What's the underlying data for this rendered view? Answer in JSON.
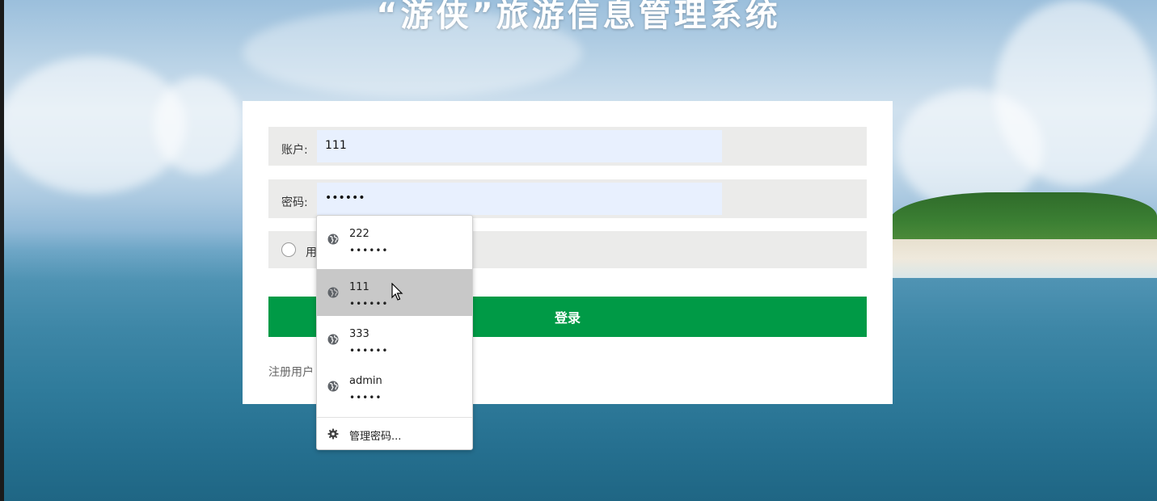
{
  "page": {
    "title": "“游侠”旅游信息管理系统"
  },
  "form": {
    "account_label": "账户:",
    "account_value": "111",
    "password_label": "密码:",
    "password_value": "••••••",
    "role_label_partial": "用",
    "login_label": "登录",
    "register_label": "注册用户"
  },
  "autocomplete": {
    "items": [
      {
        "username": "222",
        "password": "••••••",
        "icon": "globe-icon",
        "active": false
      },
      {
        "username": "111",
        "password": "••••••",
        "icon": "globe-icon",
        "active": true
      },
      {
        "username": "333",
        "password": "••••••",
        "icon": "globe-icon",
        "active": false
      },
      {
        "username": "admin",
        "password": "•••••",
        "icon": "globe-icon",
        "active": false
      }
    ],
    "manage_label": "管理密码...",
    "manage_icon": "gear-icon"
  },
  "colors": {
    "login_button": "#009a46",
    "autofill_input": "#e8f0fe",
    "row_background": "#ebebea",
    "dropdown_active": "#c8c8c8"
  }
}
